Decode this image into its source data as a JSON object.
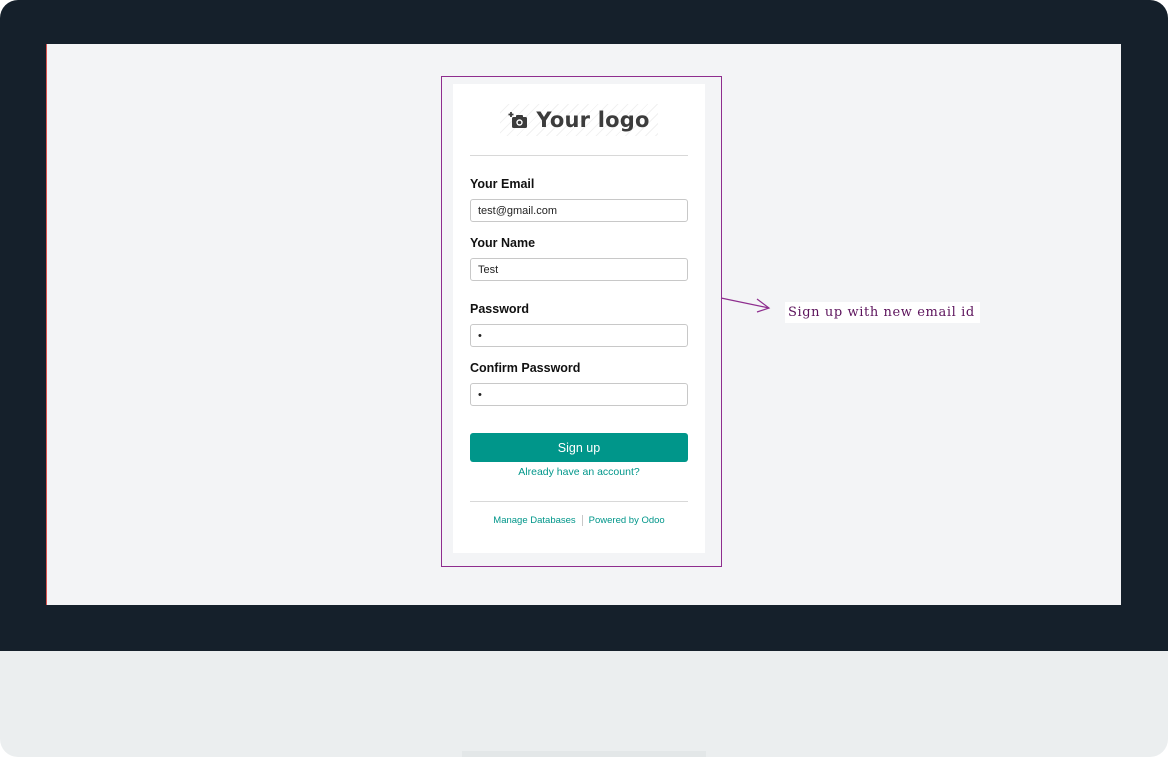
{
  "logo": {
    "text": "Your logo",
    "icon": "camera-icon"
  },
  "form": {
    "email": {
      "label": "Your Email",
      "value": "test@gmail.com"
    },
    "name": {
      "label": "Your Name",
      "value": "Test"
    },
    "password": {
      "label": "Password",
      "value": "•"
    },
    "confirm_password": {
      "label": "Confirm Password",
      "value": "•"
    },
    "submit_label": "Sign up",
    "login_link": "Already have an account?"
  },
  "footer": {
    "manage_databases": "Manage Databases",
    "powered_by": "Powered by Odoo"
  },
  "annotation": {
    "text": "Sign up with new email id"
  },
  "colors": {
    "accent": "#00968a",
    "highlight_border": "#8e2d8e",
    "annotation_text": "#5c135c",
    "bezel": "#15202b",
    "screen_bg": "#f3f4f6"
  }
}
